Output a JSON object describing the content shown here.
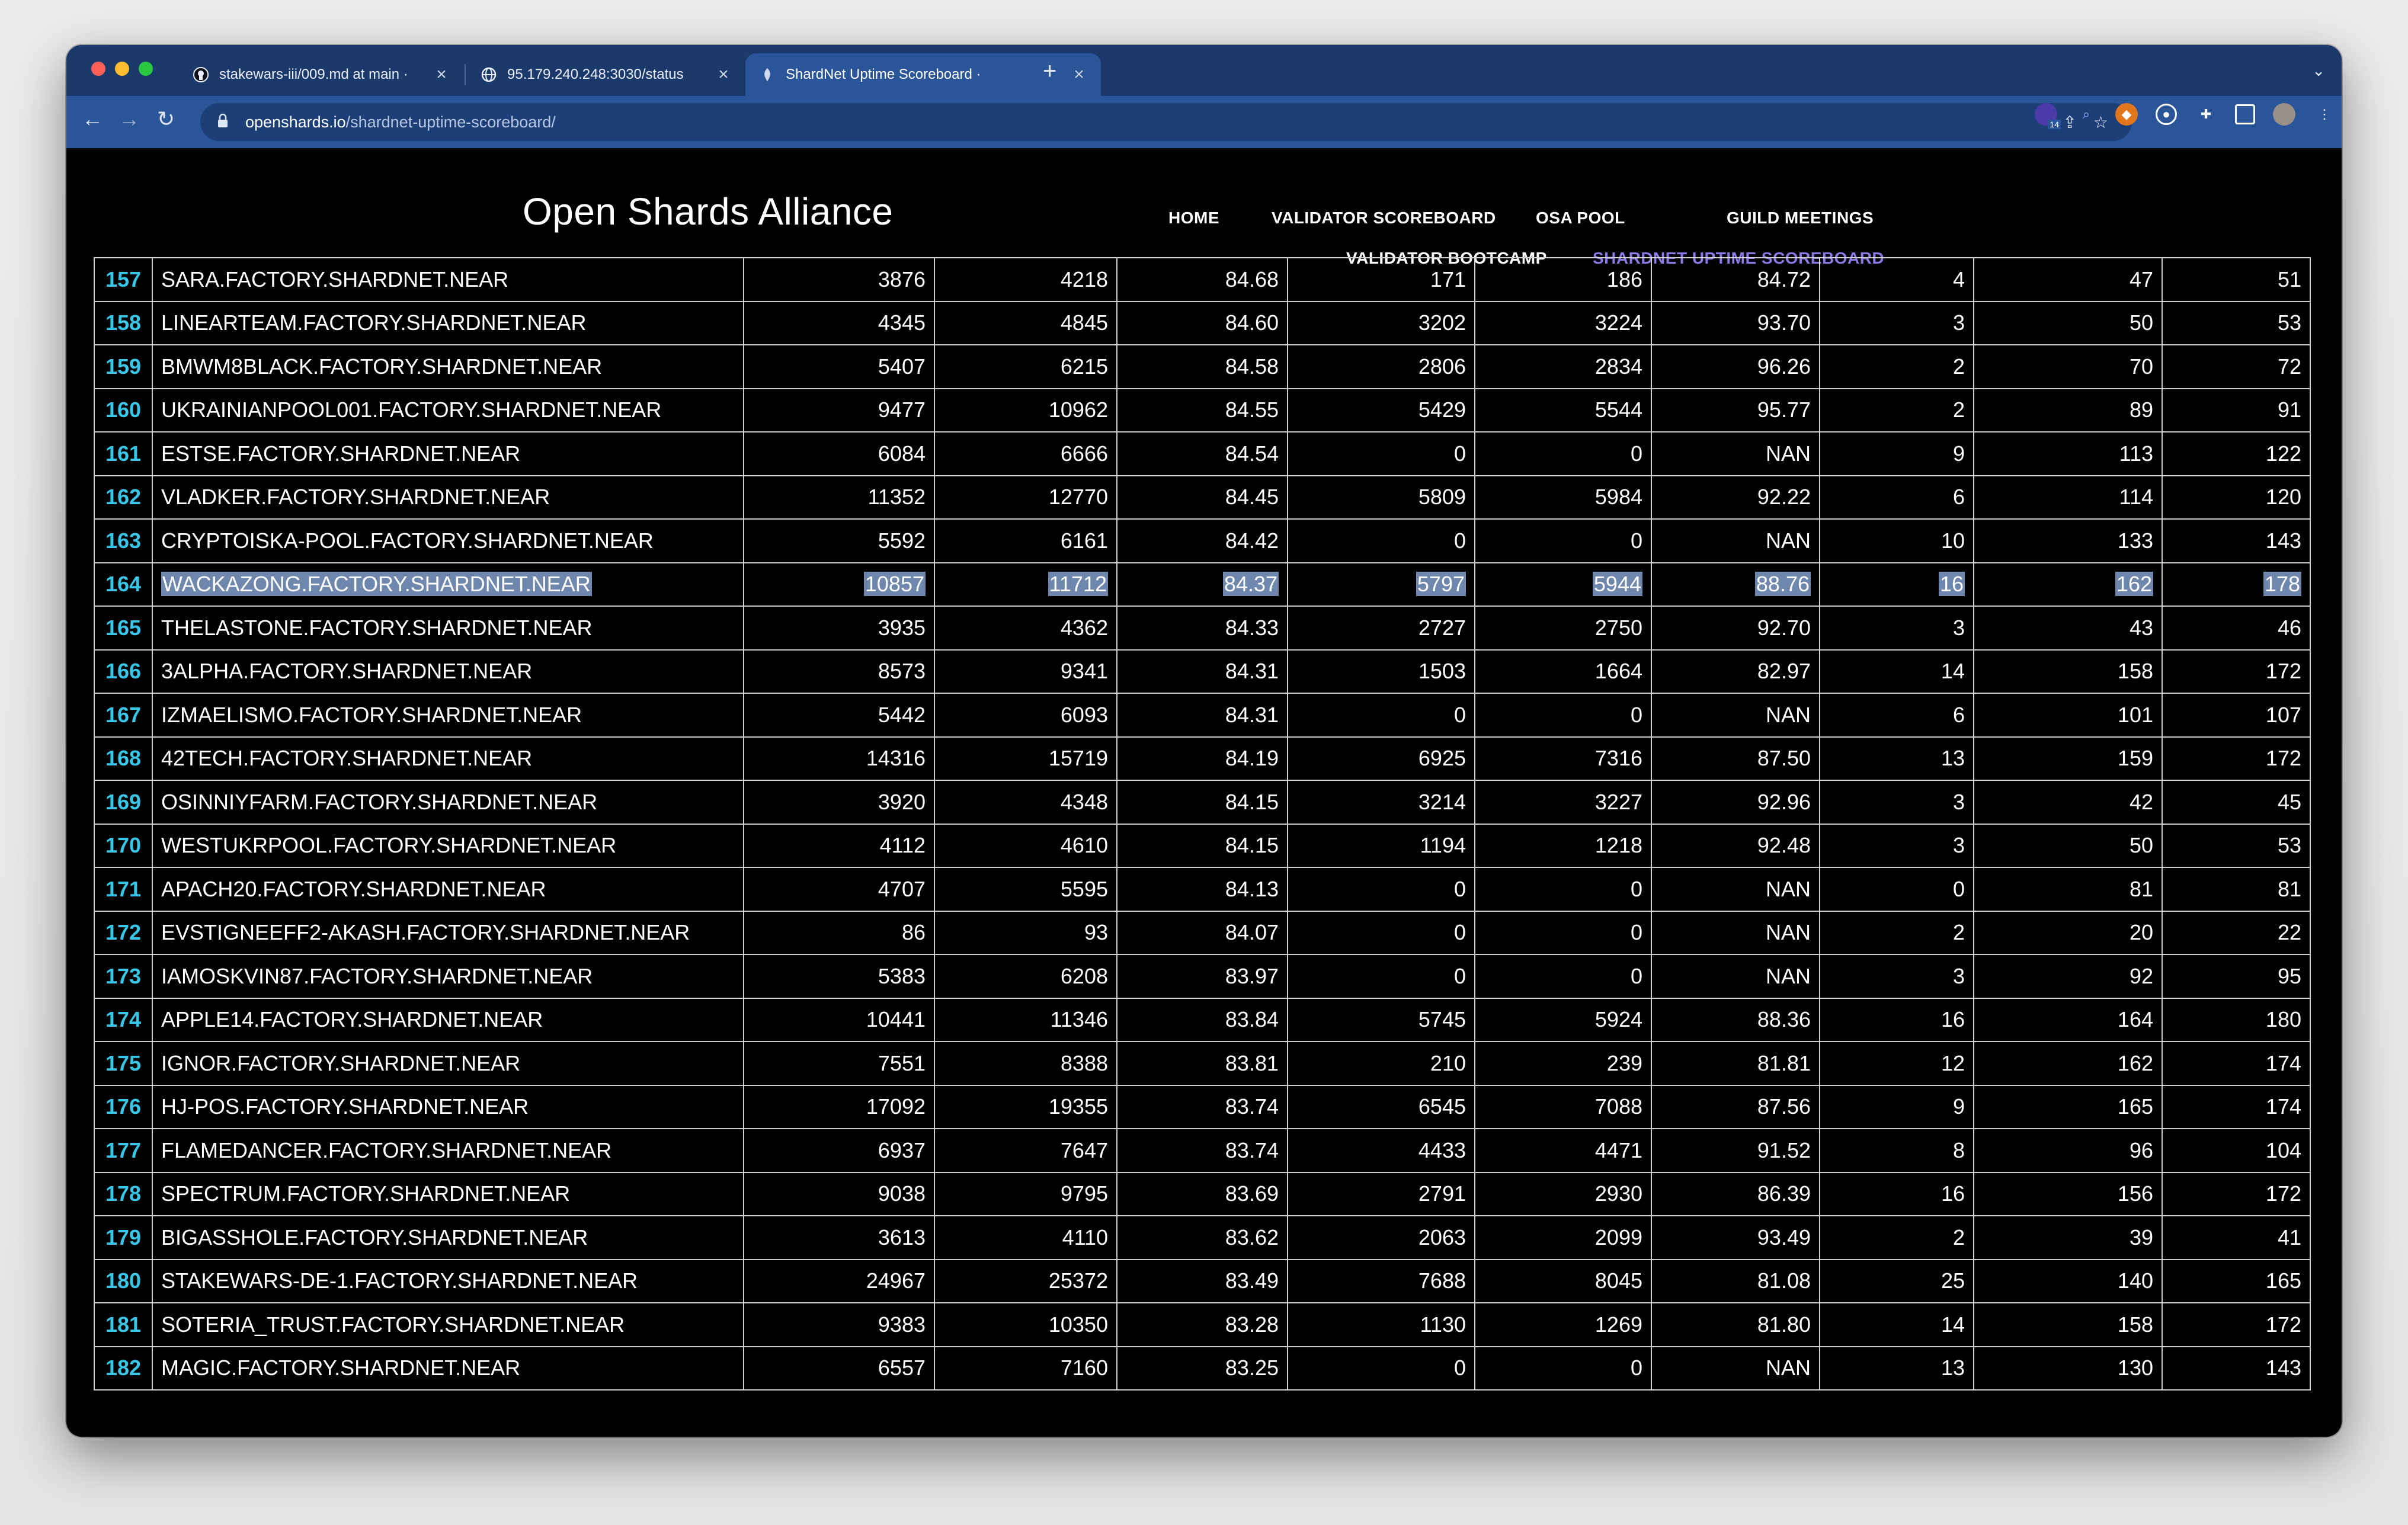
{
  "browser": {
    "tabs": [
      {
        "title": "stakewars-iii/009.md at main ·",
        "icon": "github-icon"
      },
      {
        "title": "95.179.240.248:3030/status",
        "icon": "globe-icon"
      },
      {
        "title": "ShardNet Uptime Scoreboard ·",
        "icon": "site-icon",
        "active": true
      }
    ],
    "url_host": "openshards.io",
    "url_path": "/shardnet-uptime-scoreboard/",
    "extension_badge": "14"
  },
  "header": {
    "site_title": "Open Shards Alliance",
    "nav": [
      {
        "label": "HOME"
      },
      {
        "label": "VALIDATOR SCOREBOARD"
      },
      {
        "label": "OSA POOL"
      },
      {
        "label": "GUILD MEETINGS"
      },
      {
        "label": "VALIDATOR BOOTCAMP"
      },
      {
        "label": "SHARDNET UPTIME SCOREBOARD",
        "active": true
      }
    ]
  },
  "colors": {
    "rank": "#38c7e8",
    "active_nav": "#8e78e6",
    "selection": "#6f87ad"
  },
  "table": {
    "selected_row": 164,
    "rows": [
      [
        "157",
        "SARA.FACTORY.SHARDNET.NEAR",
        "3876",
        "4218",
        "84.68",
        "171",
        "186",
        "84.72",
        "4",
        "47",
        "51"
      ],
      [
        "158",
        "LINEARTEAM.FACTORY.SHARDNET.NEAR",
        "4345",
        "4845",
        "84.60",
        "3202",
        "3224",
        "93.70",
        "3",
        "50",
        "53"
      ],
      [
        "159",
        "BMWM8BLACK.FACTORY.SHARDNET.NEAR",
        "5407",
        "6215",
        "84.58",
        "2806",
        "2834",
        "96.26",
        "2",
        "70",
        "72"
      ],
      [
        "160",
        "UKRAINIANPOOL001.FACTORY.SHARDNET.NEAR",
        "9477",
        "10962",
        "84.55",
        "5429",
        "5544",
        "95.77",
        "2",
        "89",
        "91"
      ],
      [
        "161",
        "ESTSE.FACTORY.SHARDNET.NEAR",
        "6084",
        "6666",
        "84.54",
        "0",
        "0",
        "NAN",
        "9",
        "113",
        "122"
      ],
      [
        "162",
        "VLADKER.FACTORY.SHARDNET.NEAR",
        "11352",
        "12770",
        "84.45",
        "5809",
        "5984",
        "92.22",
        "6",
        "114",
        "120"
      ],
      [
        "163",
        "CRYPTOISKA-POOL.FACTORY.SHARDNET.NEAR",
        "5592",
        "6161",
        "84.42",
        "0",
        "0",
        "NAN",
        "10",
        "133",
        "143"
      ],
      [
        "164",
        "WACKAZONG.FACTORY.SHARDNET.NEAR",
        "10857",
        "11712",
        "84.37",
        "5797",
        "5944",
        "88.76",
        "16",
        "162",
        "178"
      ],
      [
        "165",
        "THELASTONE.FACTORY.SHARDNET.NEAR",
        "3935",
        "4362",
        "84.33",
        "2727",
        "2750",
        "92.70",
        "3",
        "43",
        "46"
      ],
      [
        "166",
        "3ALPHA.FACTORY.SHARDNET.NEAR",
        "8573",
        "9341",
        "84.31",
        "1503",
        "1664",
        "82.97",
        "14",
        "158",
        "172"
      ],
      [
        "167",
        "IZMAELISMO.FACTORY.SHARDNET.NEAR",
        "5442",
        "6093",
        "84.31",
        "0",
        "0",
        "NAN",
        "6",
        "101",
        "107"
      ],
      [
        "168",
        "42TECH.FACTORY.SHARDNET.NEAR",
        "14316",
        "15719",
        "84.19",
        "6925",
        "7316",
        "87.50",
        "13",
        "159",
        "172"
      ],
      [
        "169",
        "OSINNIYFARM.FACTORY.SHARDNET.NEAR",
        "3920",
        "4348",
        "84.15",
        "3214",
        "3227",
        "92.96",
        "3",
        "42",
        "45"
      ],
      [
        "170",
        "WESTUKRPOOL.FACTORY.SHARDNET.NEAR",
        "4112",
        "4610",
        "84.15",
        "1194",
        "1218",
        "92.48",
        "3",
        "50",
        "53"
      ],
      [
        "171",
        "APACH20.FACTORY.SHARDNET.NEAR",
        "4707",
        "5595",
        "84.13",
        "0",
        "0",
        "NAN",
        "0",
        "81",
        "81"
      ],
      [
        "172",
        "EVSTIGNEEFF2-AKASH.FACTORY.SHARDNET.NEAR",
        "86",
        "93",
        "84.07",
        "0",
        "0",
        "NAN",
        "2",
        "20",
        "22"
      ],
      [
        "173",
        "IAMOSKVIN87.FACTORY.SHARDNET.NEAR",
        "5383",
        "6208",
        "83.97",
        "0",
        "0",
        "NAN",
        "3",
        "92",
        "95"
      ],
      [
        "174",
        "APPLE14.FACTORY.SHARDNET.NEAR",
        "10441",
        "11346",
        "83.84",
        "5745",
        "5924",
        "88.36",
        "16",
        "164",
        "180"
      ],
      [
        "175",
        "IGNOR.FACTORY.SHARDNET.NEAR",
        "7551",
        "8388",
        "83.81",
        "210",
        "239",
        "81.81",
        "12",
        "162",
        "174"
      ],
      [
        "176",
        "HJ-POS.FACTORY.SHARDNET.NEAR",
        "17092",
        "19355",
        "83.74",
        "6545",
        "7088",
        "87.56",
        "9",
        "165",
        "174"
      ],
      [
        "177",
        "FLAMEDANCER.FACTORY.SHARDNET.NEAR",
        "6937",
        "7647",
        "83.74",
        "4433",
        "4471",
        "91.52",
        "8",
        "96",
        "104"
      ],
      [
        "178",
        "SPECTRUM.FACTORY.SHARDNET.NEAR",
        "9038",
        "9795",
        "83.69",
        "2791",
        "2930",
        "86.39",
        "16",
        "156",
        "172"
      ],
      [
        "179",
        "BIGASSHOLE.FACTORY.SHARDNET.NEAR",
        "3613",
        "4110",
        "83.62",
        "2063",
        "2099",
        "93.49",
        "2",
        "39",
        "41"
      ],
      [
        "180",
        "STAKEWARS-DE-1.FACTORY.SHARDNET.NEAR",
        "24967",
        "25372",
        "83.49",
        "7688",
        "8045",
        "81.08",
        "25",
        "140",
        "165"
      ],
      [
        "181",
        "SOTERIA_TRUST.FACTORY.SHARDNET.NEAR",
        "9383",
        "10350",
        "83.28",
        "1130",
        "1269",
        "81.80",
        "14",
        "158",
        "172"
      ],
      [
        "182",
        "MAGIC.FACTORY.SHARDNET.NEAR",
        "6557",
        "7160",
        "83.25",
        "0",
        "0",
        "NAN",
        "13",
        "130",
        "143"
      ]
    ]
  }
}
